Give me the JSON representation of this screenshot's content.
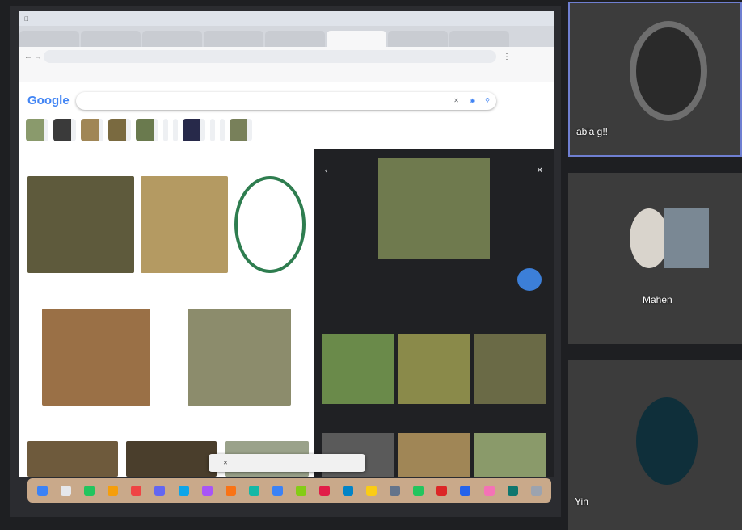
{
  "browser": {
    "tabs_count": 8,
    "bookmark_count": 8
  },
  "google": {
    "logo": "Google"
  },
  "participants": [
    {
      "name": "ab'a g!!"
    },
    {
      "name": "Mahen"
    },
    {
      "name": "Yin"
    }
  ],
  "colors": {
    "meeting_bg": "#1e1f22",
    "tile_bg": "#3c3c3c",
    "active_speaker_border": "#6f7fd1",
    "dark_panel": "#202124",
    "link_blue": "#8ab4f8"
  },
  "icons": [
    "back-icon",
    "forward-icon",
    "reload-icon",
    "search-icon",
    "camera-icon",
    "close-icon",
    "visit-icon"
  ]
}
